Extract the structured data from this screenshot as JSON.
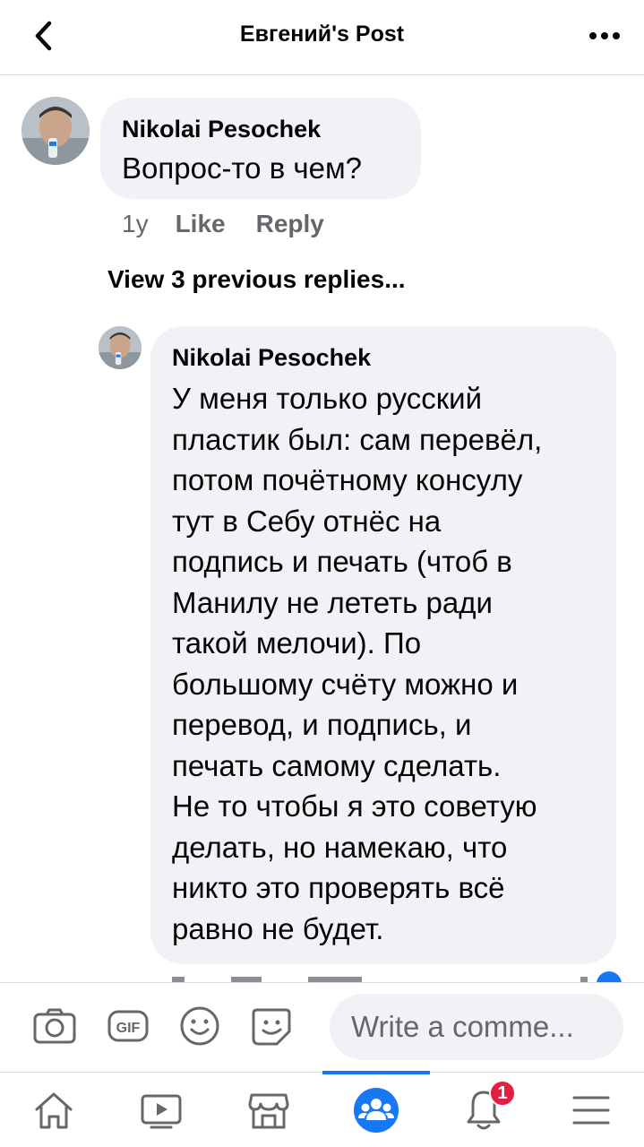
{
  "header": {
    "title": "Евгений's Post"
  },
  "comments": [
    {
      "author": "Nikolai Pesochek",
      "text": "Вопрос-то в чем?",
      "time": "1y",
      "like_label": "Like",
      "reply_label": "Reply"
    },
    {
      "author": "Nikolai Pesochek",
      "lines": [
        "У меня только русский",
        "пластик был: сам перевёл,",
        "потом почётному консулу",
        "тут в Себу отнёс на",
        "подпись и печать (чтоб в",
        "Манилу не лететь ради",
        "такой мелочи). По",
        "большому счёту можно и",
        "перевод, и подпись, и",
        "печать самому сделать.",
        "Не то чтобы я это советую",
        "делать, но намекаю, что",
        "никто это проверять всё",
        "равно не будет."
      ]
    }
  ],
  "view_replies_label": "View 3 previous replies...",
  "composer": {
    "placeholder": "Write a comme..."
  },
  "tabbar": {
    "notification_count": "1"
  },
  "colors": {
    "accent": "#1877f2",
    "bubble": "#f0f2f5",
    "badge": "#e41e3f",
    "secondary_text": "#65676b"
  }
}
